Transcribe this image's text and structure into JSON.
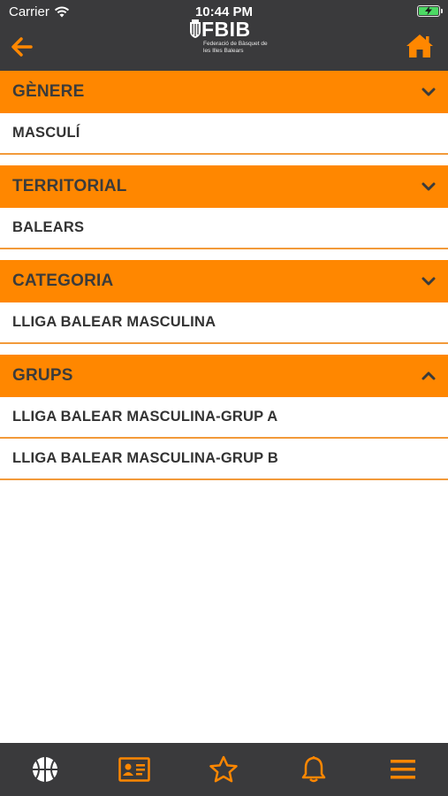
{
  "status_bar": {
    "carrier": "Carrier",
    "time": "10:44 PM"
  },
  "header": {
    "logo_text": "FBIB",
    "logo_subtitle": "Federació de Bàsquet de les Illes Balears",
    "back_icon": "arrow-left-icon",
    "home_icon": "home-icon"
  },
  "filters": [
    {
      "title": "GÈNERE",
      "expanded": false,
      "items": [
        "MASCULÍ"
      ]
    },
    {
      "title": "TERRITORIAL",
      "expanded": false,
      "items": [
        "BALEARS"
      ]
    },
    {
      "title": "CATEGORIA",
      "expanded": false,
      "items": [
        "LLIGA BALEAR MASCULINA"
      ]
    },
    {
      "title": "GRUPS",
      "expanded": true,
      "items": [
        "LLIGA BALEAR MASCULINA-GRUP A",
        "LLIGA BALEAR MASCULINA-GRUP B"
      ]
    }
  ],
  "tab_bar": {
    "tabs": [
      "basketball-icon",
      "id-card-icon",
      "star-icon",
      "bell-icon",
      "menu-icon"
    ],
    "active": 0
  },
  "colors": {
    "accent": "#ff8700",
    "bar": "#3a3a3c",
    "text": "#333333",
    "active_icon": "#ffffff",
    "inactive_icon": "#ff8700"
  }
}
